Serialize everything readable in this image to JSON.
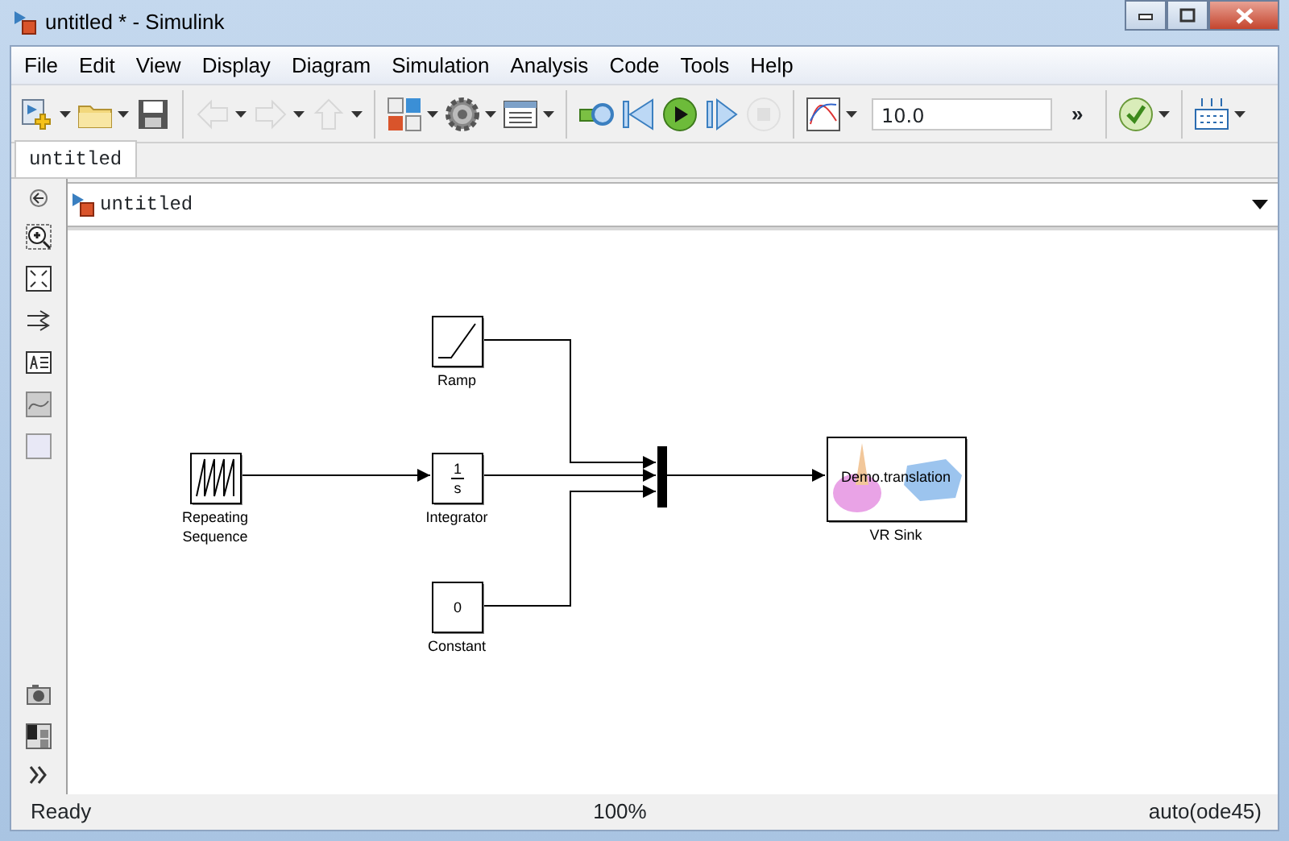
{
  "window": {
    "title": "untitled * - Simulink"
  },
  "menu": [
    {
      "label": "File"
    },
    {
      "label": "Edit"
    },
    {
      "label": "View"
    },
    {
      "label": "Display"
    },
    {
      "label": "Diagram"
    },
    {
      "label": "Simulation"
    },
    {
      "label": "Analysis"
    },
    {
      "label": "Code"
    },
    {
      "label": "Tools"
    },
    {
      "label": "Help"
    }
  ],
  "toolbar": [
    {
      "kind": "new",
      "disabled": false
    },
    {
      "kind": "open",
      "disabled": false
    },
    {
      "kind": "save",
      "disabled": false
    },
    {
      "kind": "sep"
    },
    {
      "kind": "back",
      "disabled": true
    },
    {
      "kind": "forward",
      "disabled": true
    },
    {
      "kind": "up",
      "disabled": true
    },
    {
      "kind": "sep"
    },
    {
      "kind": "library",
      "disabled": false
    },
    {
      "kind": "gear",
      "disabled": false
    },
    {
      "kind": "explorer",
      "disabled": false
    },
    {
      "kind": "sep"
    },
    {
      "kind": "update",
      "disabled": false
    },
    {
      "kind": "stepback",
      "disabled": false
    },
    {
      "kind": "run",
      "disabled": false
    },
    {
      "kind": "stepforward",
      "disabled": false
    },
    {
      "kind": "stop",
      "disabled": true
    },
    {
      "kind": "sep"
    },
    {
      "kind": "scope",
      "disabled": false
    }
  ],
  "stop_time": "10.0",
  "overflow": "»",
  "tabs": [
    {
      "label": "untitled",
      "selected": true
    }
  ],
  "breadcrumb": "untitled",
  "blocks": [
    {
      "kind": "ramp",
      "label": "Ramp"
    },
    {
      "kind": "repeating",
      "label": "Repeating\nSequence"
    },
    {
      "kind": "integrator",
      "label": "Integrator",
      "numerator": "1",
      "denominator": "s"
    },
    {
      "kind": "constant",
      "label": "Constant",
      "value": "0"
    },
    {
      "kind": "mux"
    },
    {
      "kind": "vrsink",
      "label": "VR Sink",
      "text": "Demo.translation"
    }
  ],
  "status_bar": {
    "state": "Ready",
    "zoom": "100%",
    "solver": "auto(ode45)"
  }
}
